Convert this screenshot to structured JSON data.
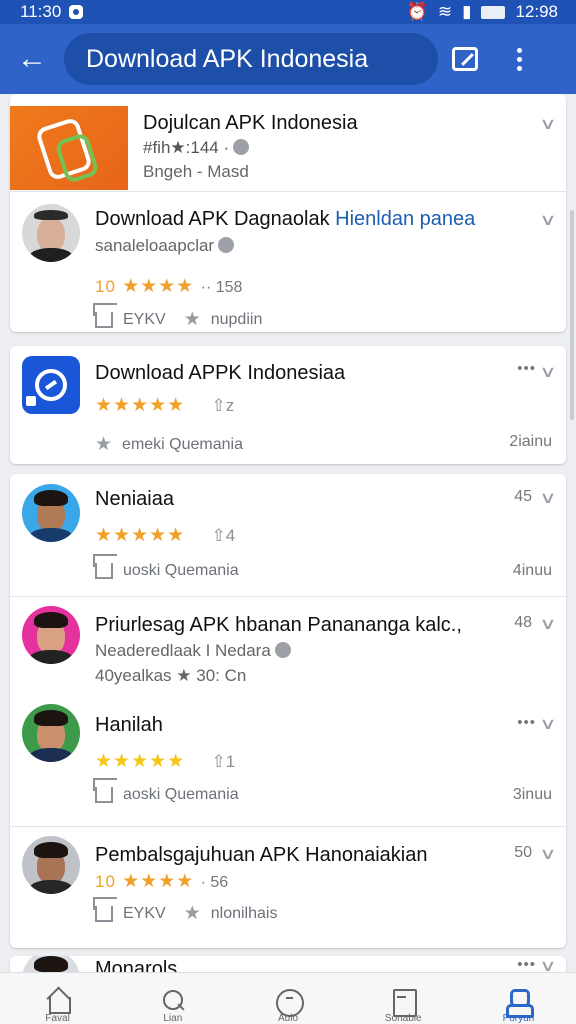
{
  "status_bar": {
    "time": "11:30",
    "clock_right": "12:98"
  },
  "app_bar": {
    "search_text": "Download APK Indonesia",
    "back_icon": "arrow-left-icon",
    "action_icon": "edit-icon",
    "menu_icon": "more-vert-icon"
  },
  "items": [
    {
      "title": "Dojulcan APK Indonesia",
      "line2": "#fih★:144 ·",
      "line3": "Bngeh - Masd"
    },
    {
      "title_main": "Download APK Dagnaolak ",
      "title_blue": "Hienldan panea",
      "line2": "sanaleloaapclar",
      "rating_num": "10",
      "stars": "★★★★",
      "rating_meta": "·· 158",
      "foot_a": "EYKV",
      "foot_b": "nupdiin"
    },
    {
      "title": "Download APPK Indonesiaa",
      "stars": "★★★★★",
      "thumb": "⇧z",
      "foot": "emeki Quemania",
      "right": "2iainu"
    },
    {
      "title": "Neniaiaa",
      "stars": "★★★★★",
      "thumb": "⇧4",
      "foot": "uoski Quemania",
      "right": "4inuu",
      "badge": "45"
    },
    {
      "title": "Priurlesag APK hbanan Panananga kalc.,",
      "line2": "Neaderedlaak I Nedara",
      "line3": "40yealkas ★ 30: Cn",
      "badge": "48"
    },
    {
      "title": "Hanilah",
      "stars": "★★★★★",
      "thumb": "⇧1",
      "foot": "aoski Quemania",
      "right": "3inuu"
    },
    {
      "title": "Pembalsgajuhuan APK Hanonaiakian",
      "rating_num": "10",
      "stars": "★★★★",
      "rating_meta": "· 56",
      "foot_a": "EYKV",
      "foot_b": "nlonilhais",
      "badge": "50"
    },
    {
      "title": "Monarols"
    }
  ],
  "bottom_nav": [
    {
      "label": "Faval",
      "icon": "home-icon"
    },
    {
      "label": "Lian",
      "icon": "search-icon"
    },
    {
      "label": "Aulo",
      "icon": "clock-icon"
    },
    {
      "label": "Sonabie",
      "icon": "file-icon"
    },
    {
      "label": "Poryun",
      "icon": "user-icon"
    }
  ],
  "colors": {
    "app_bar": "#2f63c8",
    "status_bar": "#1f52b5",
    "accent": "#2a67c8",
    "stars": "#f0a12a"
  }
}
